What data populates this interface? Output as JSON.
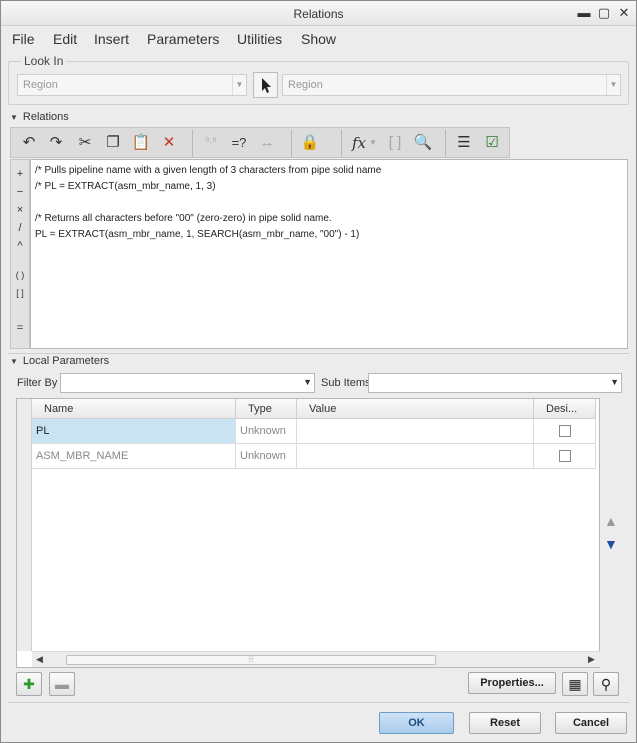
{
  "window": {
    "title": "Relations",
    "controls": {
      "minimize": "▬",
      "maximize": "▢",
      "close": "✕"
    }
  },
  "menu": [
    "File",
    "Edit",
    "Insert",
    "Parameters",
    "Utilities",
    "Show"
  ],
  "look_in": {
    "label": "Look In",
    "type_value": "Region",
    "item_value": "Region"
  },
  "relations": {
    "label": "Relations",
    "toolbar": [
      "undo-icon",
      "redo-icon",
      "cut-icon",
      "copy-icon",
      "paste-icon",
      "delete-icon",
      "units-icon",
      "evaluate-icon",
      "dimension-icon",
      "lock-icon",
      "function-icon",
      "parentheses-icon",
      "search-icon",
      "sort-icon",
      "verify-icon"
    ],
    "operators": [
      "+",
      "−",
      "×",
      "/",
      "^",
      "( )",
      "[ ]",
      "="
    ],
    "lines": [
      "/* Pulls pipeline name with a given length of 3 characters from pipe solid name",
      "/* PL = EXTRACT(asm_mbr_name, 1, 3)",
      "",
      "/* Returns all characters before \"00\" (zero-zero) in pipe solid name.",
      "PL = EXTRACT(asm_mbr_name, 1, SEARCH(asm_mbr_name, \"00\") - 1)"
    ]
  },
  "local_parameters": {
    "label": "Local Parameters",
    "filter_by_label": "Filter By",
    "filter_by_value": "",
    "sub_items_label": "Sub Items",
    "sub_items_value": "",
    "columns": [
      "Name",
      "Type",
      "Value",
      "Desi..."
    ],
    "rows": [
      {
        "name": "PL",
        "type": "Unknown",
        "value": "",
        "designated": false,
        "selected": true
      },
      {
        "name": "ASM_MBR_NAME",
        "type": "Unknown",
        "value": "",
        "designated": false,
        "selected": false
      }
    ]
  },
  "buttons": {
    "properties": "Properties...",
    "ok": "OK",
    "reset": "Reset",
    "cancel": "Cancel"
  },
  "colors": {
    "selected_row": "#c9e3f3",
    "ok_button": "#a8cbeb",
    "add_icon": "#2a9a2a",
    "move_down": "#1e4fa0"
  }
}
